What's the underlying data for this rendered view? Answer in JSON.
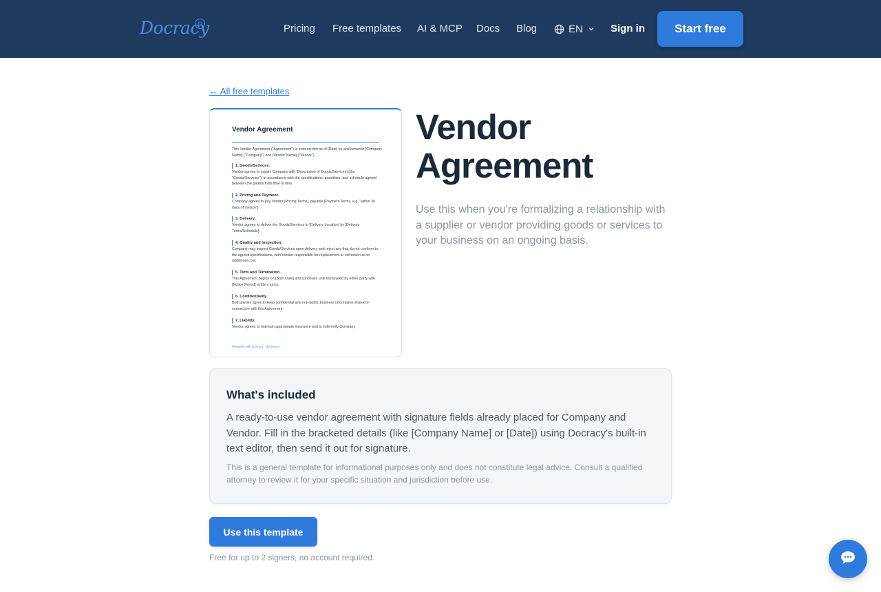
{
  "header": {
    "logo_text": "Docracy",
    "logo_badge": "io",
    "nav": [
      "Pricing",
      "Free templates",
      "AI & MCP",
      "Docs",
      "Blog"
    ],
    "language": "EN",
    "sign_in": "Sign in",
    "start_free": "Start free",
    "bg_color": "#1e3a5f",
    "accent_color": "#2f7bdd"
  },
  "back_link": "← All free templates",
  "preview": {
    "title": "Vendor Agreement",
    "intro": "This Vendor Agreement (\"Agreement\") is entered into as of [Date] by and between [Company Name] (\"Company\") and [Vendor Name] (\"Vendor\").",
    "sections": [
      {
        "heading": "1. Goods/Services.",
        "text": "Vendor agrees to supply Company with [Description of Goods/Services] (the \"Goods/Services\"), in accordance with the specifications, quantities, and schedule agreed between the parties from time to time."
      },
      {
        "heading": "2. Pricing and Payment.",
        "text": "Company agrees to pay Vendor [Pricing Terms], payable [Payment Terms, e.g. \"within 30 days of invoice\"]."
      },
      {
        "heading": "3. Delivery.",
        "text": "Vendor agrees to deliver the Goods/Services to [Delivery Location] by [Delivery Terms/Schedule]."
      },
      {
        "heading": "4. Quality and Inspection.",
        "text": "Company may inspect Goods/Services upon delivery and reject any that do not conform to the agreed specifications, with Vendor responsible for replacement or correction at no additional cost."
      },
      {
        "heading": "5. Term and Termination.",
        "text": "This Agreement begins on [Start Date] and continues until terminated by either party with [Notice Period] written notice."
      },
      {
        "heading": "6. Confidentiality.",
        "text": "Both parties agree to keep confidential any non-public business information shared in connection with this Agreement."
      },
      {
        "heading": "7. Liability.",
        "text": "Vendor agrees to maintain appropriate insurance and to indemnify Company"
      }
    ],
    "footer": "Prepared with Docracy · docracy.io"
  },
  "title": "Vendor Agreement",
  "description": "Use this when you're formalizing a relationship with a supplier or vendor providing goods or services to your business on an ongoing basis.",
  "included": {
    "heading": "What's included",
    "body": "A ready-to-use vendor agreement with signature fields already placed for Company and Vendor. Fill in the bracketed details (like [Company Name] or [Date]) using Docracy's built-in text editor, then send it out for signature.",
    "disclaimer": "This is a general template for informational purposes only and does not constitute legal advice. Consult a qualified attorney to review it for your specific situation and jurisdiction before use."
  },
  "cta": {
    "button": "Use this template",
    "note": "Free for up to 2 signers, no account required."
  },
  "chat": {
    "icon": "chat-bubble-icon"
  }
}
